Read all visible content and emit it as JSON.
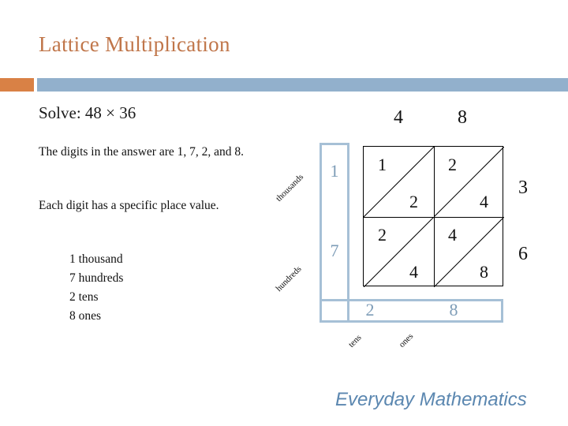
{
  "slide": {
    "title": "Lattice Multiplication",
    "problem": "Solve: 48 × 36",
    "explanation_1": "The digits in the answer are 1, 7, 2, and 8.",
    "explanation_2": "Each digit has a specific place value.",
    "place_values": [
      "1 thousand",
      "7 hundreds",
      "2 tens",
      "8 ones"
    ],
    "footer": "Everyday Mathematics"
  },
  "colors": {
    "title": "#c0764a",
    "rule_orange": "#d98145",
    "rule_blue": "#92b0cc",
    "highlight": "#a6c0d6",
    "highlight_text": "#7d9cb7",
    "footer": "#5b87b0"
  },
  "lattice": {
    "top_digits": [
      "4",
      "8"
    ],
    "side_digits": [
      "3",
      "6"
    ],
    "cells": [
      {
        "upper": "1",
        "lower": "2"
      },
      {
        "upper": "2",
        "lower": "4"
      },
      {
        "upper": "2",
        "lower": "4"
      },
      {
        "upper": "4",
        "lower": "8"
      }
    ],
    "answer_digits": {
      "thousands": "1",
      "hundreds": "7",
      "tens": "2",
      "ones": "8"
    },
    "place_labels": {
      "thousands": "thousands",
      "hundreds": "hundreds",
      "tens": "tens",
      "ones": "ones"
    }
  }
}
